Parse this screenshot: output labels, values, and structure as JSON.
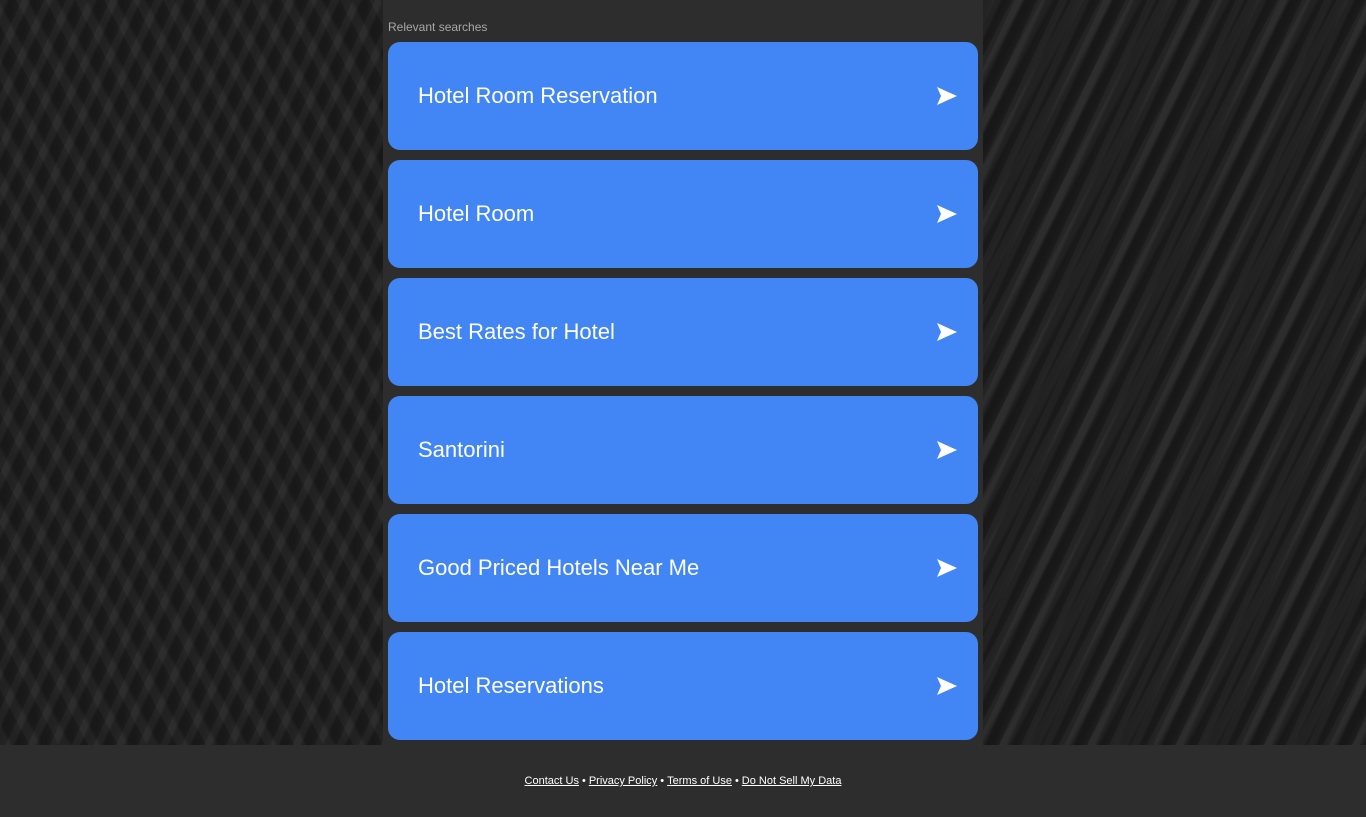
{
  "section": {
    "label": "Relevant searches"
  },
  "results": [
    {
      "label": "Hotel Room Reservation"
    },
    {
      "label": "Hotel Room"
    },
    {
      "label": "Best Rates for Hotel"
    },
    {
      "label": "Santorini"
    },
    {
      "label": "Good Priced Hotels Near Me"
    },
    {
      "label": "Hotel Reservations"
    }
  ],
  "result_icon": "arrow-right-icon",
  "colors": {
    "button_bg": "#4285f4",
    "panel_bg": "#2d2d2d",
    "page_bg": "#1e1e1e",
    "text": "#ffffff"
  },
  "footer": {
    "links": [
      {
        "label": "Contact Us"
      },
      {
        "label": "Privacy Policy"
      },
      {
        "label": "Terms of Use"
      },
      {
        "label": "Do Not Sell My Data"
      }
    ],
    "separator": "•"
  }
}
